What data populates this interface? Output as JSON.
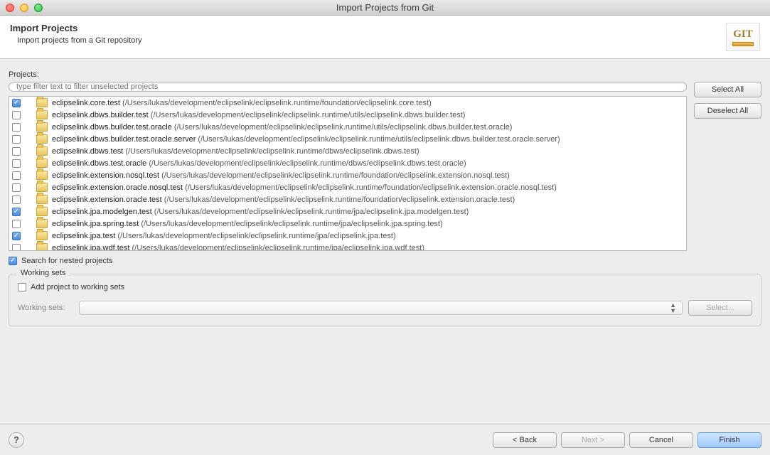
{
  "window_title": "Import Projects from Git",
  "header": {
    "title": "Import Projects",
    "subtitle": "Import projects from a Git repository",
    "logo_text": "GIT"
  },
  "projects_label": "Projects:",
  "filter_placeholder": "type filter text to filter unselected projects",
  "buttons": {
    "select_all": "Select All",
    "deselect_all": "Deselect All",
    "select": "Select..."
  },
  "nested_checkbox_label": "Search for nested projects",
  "nested_checked": true,
  "working_sets": {
    "legend": "Working sets",
    "add_label": "Add project to working sets",
    "add_checked": false,
    "combo_label": "Working sets:"
  },
  "footer": {
    "back": "< Back",
    "next": "Next >",
    "cancel": "Cancel",
    "finish": "Finish"
  },
  "projects": [
    {
      "checked": true,
      "name": "eclipselink.core.test",
      "path": "/Users/lukas/development/eclipselink/eclipselink.runtime/foundation/eclipselink.core.test"
    },
    {
      "checked": false,
      "name": "eclipselink.dbws.builder.test",
      "path": "/Users/lukas/development/eclipselink/eclipselink.runtime/utils/eclipselink.dbws.builder.test"
    },
    {
      "checked": false,
      "name": "eclipselink.dbws.builder.test.oracle",
      "path": "/Users/lukas/development/eclipselink/eclipselink.runtime/utils/eclipselink.dbws.builder.test.oracle"
    },
    {
      "checked": false,
      "name": "eclipselink.dbws.builder.test.oracle.server",
      "path": "/Users/lukas/development/eclipselink/eclipselink.runtime/utils/eclipselink.dbws.builder.test.oracle.server"
    },
    {
      "checked": false,
      "name": "eclipselink.dbws.test",
      "path": "/Users/lukas/development/eclipselink/eclipselink.runtime/dbws/eclipselink.dbws.test"
    },
    {
      "checked": false,
      "name": "eclipselink.dbws.test.oracle",
      "path": "/Users/lukas/development/eclipselink/eclipselink.runtime/dbws/eclipselink.dbws.test.oracle"
    },
    {
      "checked": false,
      "name": "eclipselink.extension.nosql.test",
      "path": "/Users/lukas/development/eclipselink/eclipselink.runtime/foundation/eclipselink.extension.nosql.test"
    },
    {
      "checked": false,
      "name": "eclipselink.extension.oracle.nosql.test",
      "path": "/Users/lukas/development/eclipselink/eclipselink.runtime/foundation/eclipselink.extension.oracle.nosql.test"
    },
    {
      "checked": false,
      "name": "eclipselink.extension.oracle.test",
      "path": "/Users/lukas/development/eclipselink/eclipselink.runtime/foundation/eclipselink.extension.oracle.test"
    },
    {
      "checked": true,
      "name": "eclipselink.jpa.modelgen.test",
      "path": "/Users/lukas/development/eclipselink/eclipselink.runtime/jpa/eclipselink.jpa.modelgen.test"
    },
    {
      "checked": false,
      "name": "eclipselink.jpa.spring.test",
      "path": "/Users/lukas/development/eclipselink/eclipselink.runtime/jpa/eclipselink.jpa.spring.test"
    },
    {
      "checked": true,
      "name": "eclipselink.jpa.test",
      "path": "/Users/lukas/development/eclipselink/eclipselink.runtime/jpa/eclipselink.jpa.test"
    },
    {
      "checked": false,
      "name": "eclipselink.jpa.wdf.test",
      "path": "/Users/lukas/development/eclipselink/eclipselink.runtime/jpa/eclipselink.jpa.wdf.test"
    }
  ]
}
